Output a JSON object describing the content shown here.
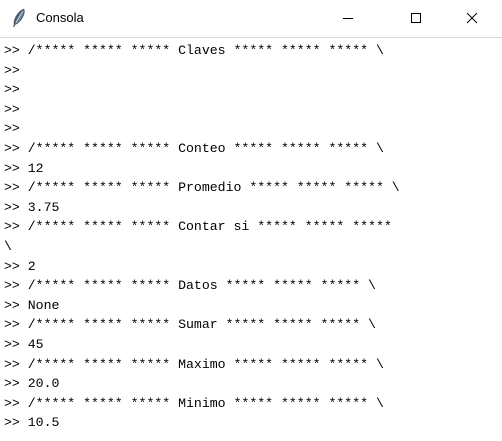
{
  "window": {
    "title": "Consola",
    "icons": {
      "app": "feather-icon",
      "minimize": "minimize-icon",
      "maximize": "maximize-icon",
      "close": "close-icon"
    }
  },
  "console": {
    "prompt": ">>",
    "lines": [
      ">> /***** ***** ***** Claves ***** ***** ***** \\",
      ">>",
      ">>",
      ">>",
      ">>",
      ">> /***** ***** ***** Conteo ***** ***** ***** \\",
      ">> 12",
      ">> /***** ***** ***** Promedio ***** ***** ***** \\",
      ">> 3.75",
      ">> /***** ***** ***** Contar si ***** ***** *****",
      "\\",
      ">> 2",
      ">> /***** ***** ***** Datos ***** ***** ***** \\",
      ">> None",
      ">> /***** ***** ***** Sumar ***** ***** ***** \\",
      ">> 45",
      ">> /***** ***** ***** Maximo ***** ***** ***** \\",
      ">> 20.0",
      ">> /***** ***** ***** Minimo ***** ***** ***** \\",
      ">> 10.5"
    ]
  }
}
